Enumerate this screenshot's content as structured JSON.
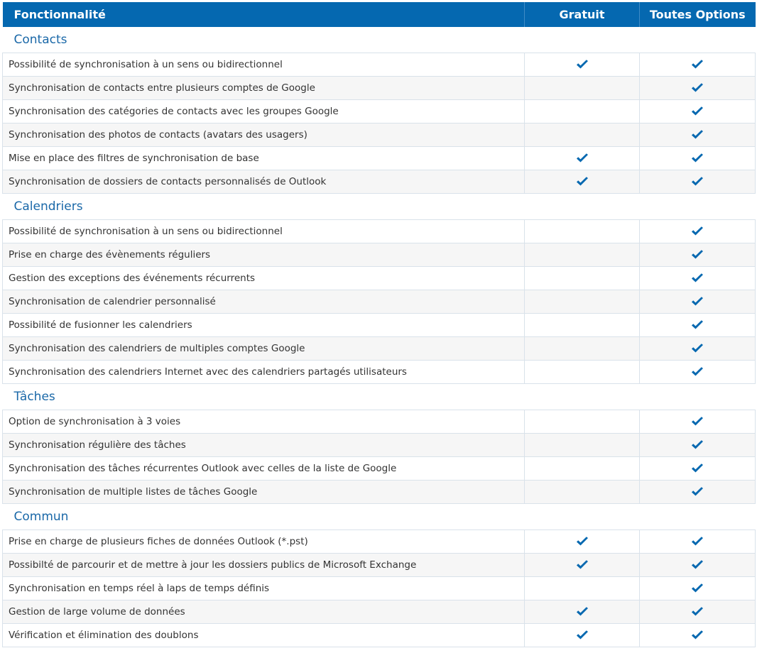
{
  "header": {
    "feature_label": "Fonctionnalité",
    "free_label": "Gratuit",
    "all_label": "Toutes Options"
  },
  "icons": {
    "check": "check-icon",
    "check_color": "#0568b0"
  },
  "sections": [
    {
      "title": "Contacts",
      "rows": [
        {
          "feature": "Possibilité de synchronisation à un sens ou bidirectionnel",
          "free": true,
          "all": true
        },
        {
          "feature": "Synchronisation de contacts entre plusieurs comptes de Google",
          "free": false,
          "all": true
        },
        {
          "feature": "Synchronisation des catégories de contacts avec les groupes Google",
          "free": false,
          "all": true
        },
        {
          "feature": "Synchronisation des photos de contacts (avatars des usagers)",
          "free": false,
          "all": true
        },
        {
          "feature": "Mise en place des filtres de synchronisation de base",
          "free": true,
          "all": true
        },
        {
          "feature": "Synchronisation de dossiers de contacts personnalisés de Outlook",
          "free": true,
          "all": true
        }
      ]
    },
    {
      "title": "Calendriers",
      "rows": [
        {
          "feature": "Possibilité de synchronisation à un sens ou bidirectionnel",
          "free": false,
          "all": true
        },
        {
          "feature": "Prise en charge des évènements réguliers",
          "free": false,
          "all": true
        },
        {
          "feature": "Gestion des exceptions des événements récurrents",
          "free": false,
          "all": true
        },
        {
          "feature": "Synchronisation de calendrier personnalisé",
          "free": false,
          "all": true
        },
        {
          "feature": "Possibilité de fusionner les calendriers",
          "free": false,
          "all": true
        },
        {
          "feature": "Synchronisation des calendriers de multiples comptes Google",
          "free": false,
          "all": true
        },
        {
          "feature": "Synchronisation des calendriers Internet avec des calendriers partagés utilisateurs",
          "free": false,
          "all": true
        }
      ]
    },
    {
      "title": "Tâches",
      "rows": [
        {
          "feature": "Option de synchronisation à 3 voies",
          "free": false,
          "all": true
        },
        {
          "feature": "Synchronisation régulière des tâches",
          "free": false,
          "all": true
        },
        {
          "feature": "Synchronisation des tâches récurrentes Outlook avec celles de la liste de Google",
          "free": false,
          "all": true
        },
        {
          "feature": "Synchronisation de multiple listes de tâches Google",
          "free": false,
          "all": true
        }
      ]
    },
    {
      "title": "Commun",
      "rows": [
        {
          "feature": "Prise en charge de plusieurs fiches de données Outlook (*.pst)",
          "free": true,
          "all": true
        },
        {
          "feature": "Possibilté de parcourir et de mettre à jour les dossiers publics de Microsoft Exchange",
          "free": true,
          "all": true
        },
        {
          "feature": "Synchronisation en temps réel à laps de temps définis",
          "free": false,
          "all": true
        },
        {
          "feature": "Gestion de large volume de données",
          "free": true,
          "all": true
        },
        {
          "feature": "Vérification et élimination des doublons",
          "free": true,
          "all": true
        }
      ]
    }
  ]
}
